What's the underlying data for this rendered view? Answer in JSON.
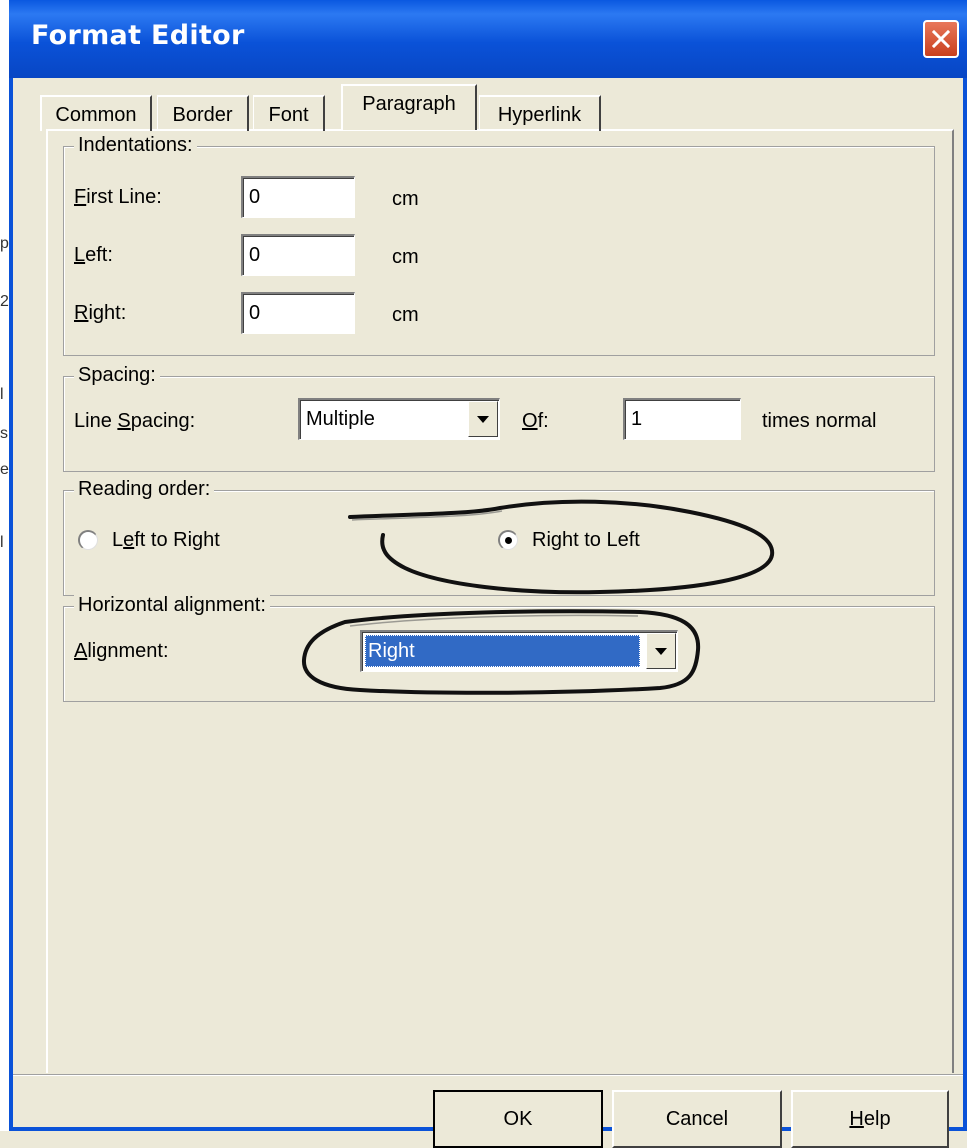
{
  "window": {
    "title": "Format Editor",
    "close_icon": "close-icon"
  },
  "colors": {
    "titlebar": "#0a52d8",
    "dialog_bg": "#ece9d8",
    "selection": "#316ac5",
    "close_button": "#d9542f"
  },
  "tabs": [
    {
      "label": "Common",
      "selected": false
    },
    {
      "label": "Border",
      "selected": false
    },
    {
      "label": "Font",
      "selected": false
    },
    {
      "label": "Paragraph",
      "selected": true
    },
    {
      "label": "Hyperlink",
      "selected": false
    }
  ],
  "indentations": {
    "legend": "Indentations:",
    "first_line": {
      "label": "First Line:",
      "value": "0",
      "unit": "cm"
    },
    "left": {
      "label": "Left:",
      "value": "0",
      "unit": "cm"
    },
    "right": {
      "label": "Right:",
      "value": "0",
      "unit": "cm"
    }
  },
  "spacing": {
    "legend": "Spacing:",
    "line_spacing_label": "Line Spacing:",
    "line_spacing_value": "Multiple",
    "of_label": "Of:",
    "of_value": "1",
    "unit": "times normal"
  },
  "reading_order": {
    "legend": "Reading order:",
    "options": [
      {
        "label": "Left to Right",
        "selected": false
      },
      {
        "label": "Right to Left",
        "selected": true
      }
    ]
  },
  "horizontal_alignment": {
    "legend": "Horizontal alignment:",
    "alignment_label": "Alignment:",
    "alignment_value": "Right"
  },
  "buttons": {
    "ok": "OK",
    "cancel": "Cancel",
    "help": "Help"
  },
  "background_fragments": [
    "p",
    "2",
    "l",
    "s",
    "e",
    "l"
  ]
}
